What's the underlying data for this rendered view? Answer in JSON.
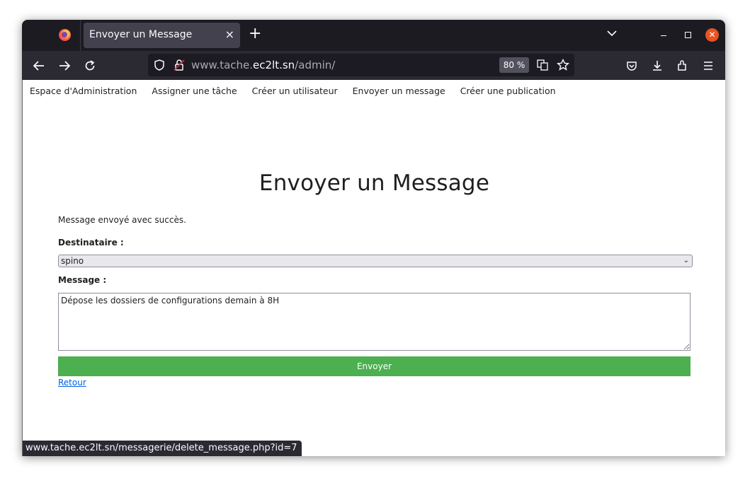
{
  "browser": {
    "tab_title": "Envoyer un Message",
    "tab_close": "×",
    "new_tab": "+",
    "url_prefix": "www.tache.",
    "url_host": "ec2lt.sn",
    "url_path": "/admin/",
    "zoom": "80 %",
    "status_url": "www.tache.ec2lt.sn/messagerie/delete_message.php?id=7"
  },
  "nav": {
    "items": [
      "Espace d'Administration",
      "Assigner une tâche",
      "Créer un utilisateur",
      "Envoyer un message",
      "Créer une publication"
    ]
  },
  "page": {
    "title": "Envoyer un Message",
    "success_message": "Message envoyé avec succès.",
    "recipient_label": "Destinataire :",
    "recipient_value": "spino",
    "message_label": "Message :",
    "message_value": "Dépose les dossiers de configurations demain à 8H",
    "send_button": "Envoyer",
    "back_link": "Retour"
  },
  "colors": {
    "send_button_bg": "#4caf50",
    "link": "#0060df",
    "tabbar": "#1c1b22",
    "toolbar": "#2b2a33"
  }
}
